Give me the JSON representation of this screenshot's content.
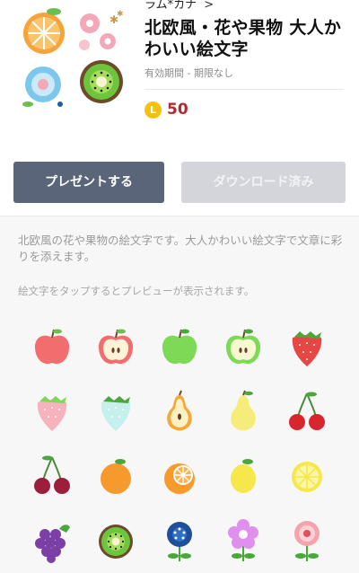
{
  "product": {
    "author": "ラム*カナ",
    "author_chevron": ">",
    "title": "北欧風・花や果物 大人かわいい絵文字",
    "validity": "有効期間 - 期限なし",
    "coin_symbol": "L",
    "price": "50"
  },
  "actions": {
    "present_label": "プレゼントする",
    "download_label": "ダウンロード済み"
  },
  "description": "北欧風の花や果物の絵文字です。大人かわいい絵文字で文章に彩りを添えます。",
  "preview_hint": "絵文字をタップするとプレビューが表示されます。",
  "emoji_grid": [
    "apple-red",
    "apple-red-cut",
    "apple-green",
    "apple-green-cut",
    "strawberry-red",
    "strawberry-pink",
    "strawberry-mint",
    "pear-cut",
    "pear-yellow",
    "cherries-red",
    "cherries-dark",
    "orange",
    "orange-cut",
    "lemon",
    "lemon-slice",
    "grapes",
    "kiwi",
    "flower-blue",
    "flower-purple",
    "flower-pink"
  ],
  "colors": {
    "present_button": "#5b6579",
    "download_button": "#d3d5db",
    "price": "#b8262e",
    "coin": "#f4c20d"
  }
}
